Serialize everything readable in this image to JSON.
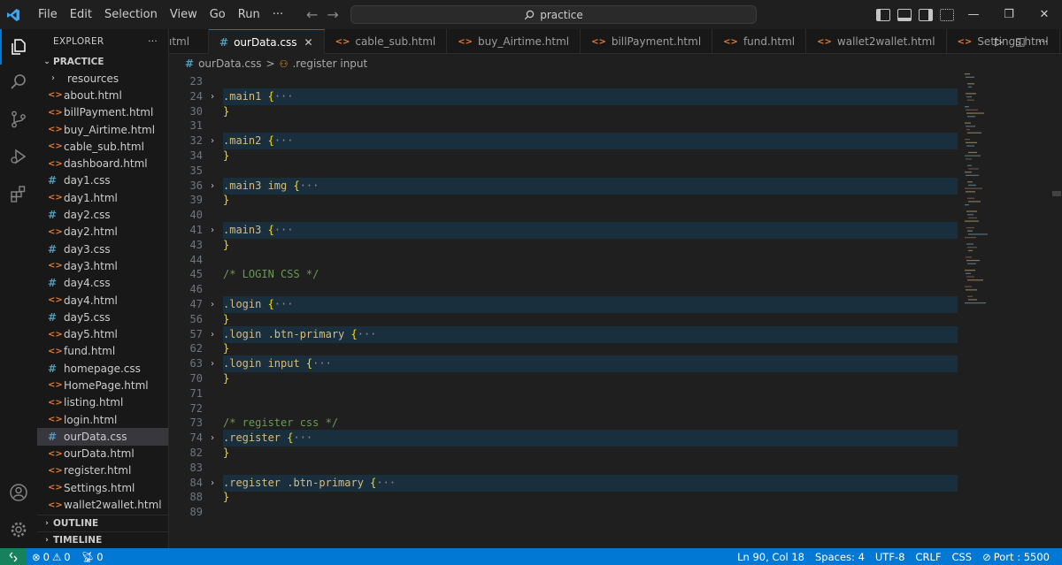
{
  "titlebar": {
    "menu": [
      "File",
      "Edit",
      "Selection",
      "View",
      "Go",
      "Run",
      "···"
    ],
    "search": "practice",
    "icons": [
      "vscode-logo-icon",
      "back-arrow-icon",
      "forward-arrow-icon",
      "search-icon",
      "toggle-primary-sidebar-icon",
      "toggle-panel-icon",
      "toggle-secondary-sidebar-icon",
      "customize-layout-icon",
      "minimize-icon",
      "restore-icon",
      "close-icon"
    ]
  },
  "activitybar": [
    "explorer-icon",
    "search-icon",
    "source-control-icon",
    "run-debug-icon",
    "extensions-icon",
    "accounts-icon",
    "manage-gear-icon"
  ],
  "sidebar": {
    "title": "EXPLORER",
    "more": "···",
    "root": "PRACTICE",
    "files": [
      {
        "name": "resources",
        "type": "folder"
      },
      {
        "name": "about.html",
        "type": "html"
      },
      {
        "name": "billPayment.html",
        "type": "html"
      },
      {
        "name": "buy_Airtime.html",
        "type": "html"
      },
      {
        "name": "cable_sub.html",
        "type": "html"
      },
      {
        "name": "dashboard.html",
        "type": "html"
      },
      {
        "name": "day1.css",
        "type": "css"
      },
      {
        "name": "day1.html",
        "type": "html"
      },
      {
        "name": "day2.css",
        "type": "css"
      },
      {
        "name": "day2.html",
        "type": "html"
      },
      {
        "name": "day3.css",
        "type": "css"
      },
      {
        "name": "day3.html",
        "type": "html"
      },
      {
        "name": "day4.css",
        "type": "css"
      },
      {
        "name": "day4.html",
        "type": "html"
      },
      {
        "name": "day5.css",
        "type": "css"
      },
      {
        "name": "day5.html",
        "type": "html"
      },
      {
        "name": "fund.html",
        "type": "html"
      },
      {
        "name": "homepage.css",
        "type": "css"
      },
      {
        "name": "HomePage.html",
        "type": "html"
      },
      {
        "name": "listing.html",
        "type": "html"
      },
      {
        "name": "login.html",
        "type": "html"
      },
      {
        "name": "ourData.css",
        "type": "css",
        "active": true
      },
      {
        "name": "ourData.html",
        "type": "html"
      },
      {
        "name": "register.html",
        "type": "html"
      },
      {
        "name": "Settings.html",
        "type": "html"
      },
      {
        "name": "wallet2wallet.html",
        "type": "html"
      }
    ],
    "outline": "OUTLINE",
    "timeline": "TIMELINE"
  },
  "tabs": [
    {
      "label": "ıtml",
      "type": "html"
    },
    {
      "label": "ourData.css",
      "type": "css",
      "active": true
    },
    {
      "label": "cable_sub.html",
      "type": "html"
    },
    {
      "label": "buy_Airtime.html",
      "type": "html"
    },
    {
      "label": "billPayment.html",
      "type": "html"
    },
    {
      "label": "fund.html",
      "type": "html"
    },
    {
      "label": "wallet2wallet.html",
      "type": "html"
    },
    {
      "label": "Settings.html",
      "type": "html"
    }
  ],
  "breadcrumb": {
    "icon": "#",
    "file": "ourData.css",
    "separator": ">",
    "symbol": ".register input"
  },
  "code": [
    {
      "n": "23",
      "text": ""
    },
    {
      "n": "24",
      "sel": ".main1",
      "folded": true
    },
    {
      "n": "30",
      "text": "}"
    },
    {
      "n": "31",
      "text": ""
    },
    {
      "n": "32",
      "sel": ".main2",
      "folded": true
    },
    {
      "n": "34",
      "text": "}"
    },
    {
      "n": "35",
      "text": ""
    },
    {
      "n": "36",
      "sel": ".main3 img",
      "folded": true
    },
    {
      "n": "39",
      "text": "}"
    },
    {
      "n": "40",
      "text": ""
    },
    {
      "n": "41",
      "sel": ".main3",
      "folded": true
    },
    {
      "n": "43",
      "text": "}"
    },
    {
      "n": "44",
      "text": ""
    },
    {
      "n": "45",
      "comment": "/* LOGIN CSS */"
    },
    {
      "n": "46",
      "text": ""
    },
    {
      "n": "47",
      "sel": ".login",
      "folded": true
    },
    {
      "n": "56",
      "text": "}"
    },
    {
      "n": "57",
      "sel": ".login .btn-primary",
      "folded": true
    },
    {
      "n": "62",
      "text": "}"
    },
    {
      "n": "63",
      "sel": ".login input",
      "folded": true
    },
    {
      "n": "70",
      "text": "}"
    },
    {
      "n": "71",
      "text": ""
    },
    {
      "n": "72",
      "text": ""
    },
    {
      "n": "73",
      "comment": "/* register css */"
    },
    {
      "n": "74",
      "sel": ".register",
      "folded": true
    },
    {
      "n": "82",
      "text": "}"
    },
    {
      "n": "83",
      "text": ""
    },
    {
      "n": "84",
      "sel": ".register .btn-primary",
      "folded": true
    },
    {
      "n": "88",
      "text": "}"
    },
    {
      "n": "89",
      "text": ""
    }
  ],
  "statusbar": {
    "errors": "0",
    "warnings": "0",
    "ports": "0",
    "position": "Ln 90, Col 18",
    "spaces": "Spaces: 4",
    "encoding": "UTF-8",
    "eol": "CRLF",
    "language": "CSS",
    "port": "Port : 5500"
  },
  "colors": {
    "accent": "#0078d4",
    "html_icon": "#e37933",
    "css_icon": "#519aba",
    "selector": "#d7ba7d",
    "brace": "#ffd700",
    "comment": "#6a9955"
  }
}
